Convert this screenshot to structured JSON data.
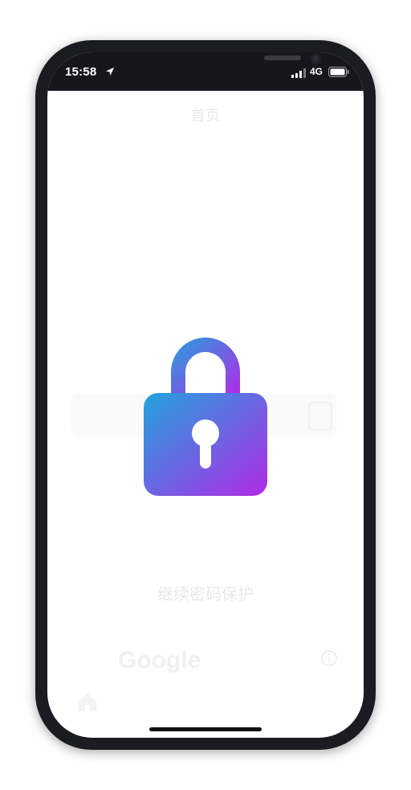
{
  "status_bar": {
    "time": "15:58",
    "network": "4G",
    "icons": [
      "location-arrow-icon",
      "cellular-signal-icon",
      "battery-icon"
    ]
  },
  "background": {
    "page_title": "首页",
    "caption": "继续密码保护",
    "brand": "Google"
  },
  "overlay": {
    "icon": "lock-icon",
    "gradient_start": "#23a3de",
    "gradient_end": "#b12ae6"
  },
  "colors": {
    "frame": "#1b1b22",
    "status_bar": "#16161c",
    "screen": "#ffffff"
  }
}
